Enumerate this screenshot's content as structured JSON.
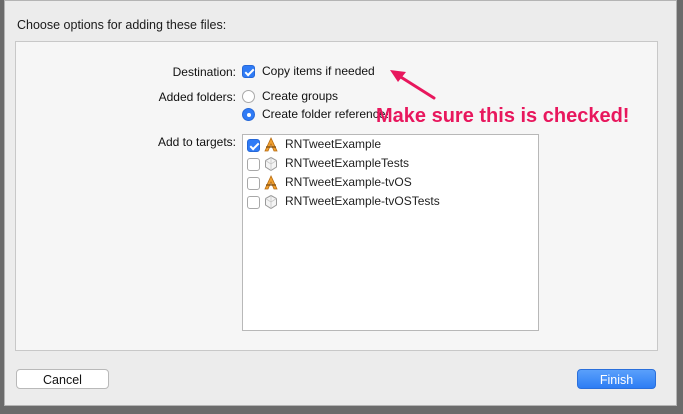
{
  "dialog": {
    "title": "Choose options for adding these files:"
  },
  "destination": {
    "label": "Destination:",
    "checkbox_label": "Copy items if needed",
    "checked": true
  },
  "added_folders": {
    "label": "Added folders:",
    "options": [
      {
        "label": "Create groups",
        "selected": false
      },
      {
        "label": "Create folder references",
        "selected": true
      }
    ]
  },
  "targets": {
    "label": "Add to targets:",
    "items": [
      {
        "name": "RNTweetExample",
        "checked": true,
        "icon": "app-icon"
      },
      {
        "name": "RNTweetExampleTests",
        "checked": false,
        "icon": "test-bundle-icon"
      },
      {
        "name": "RNTweetExample-tvOS",
        "checked": false,
        "icon": "app-icon"
      },
      {
        "name": "RNTweetExample-tvOSTests",
        "checked": false,
        "icon": "test-bundle-icon"
      }
    ]
  },
  "annotation": {
    "text": "Make sure this is checked!",
    "color": "#e8175d"
  },
  "buttons": {
    "cancel": "Cancel",
    "finish": "Finish"
  },
  "colors": {
    "accent": "#2f7bf6"
  }
}
